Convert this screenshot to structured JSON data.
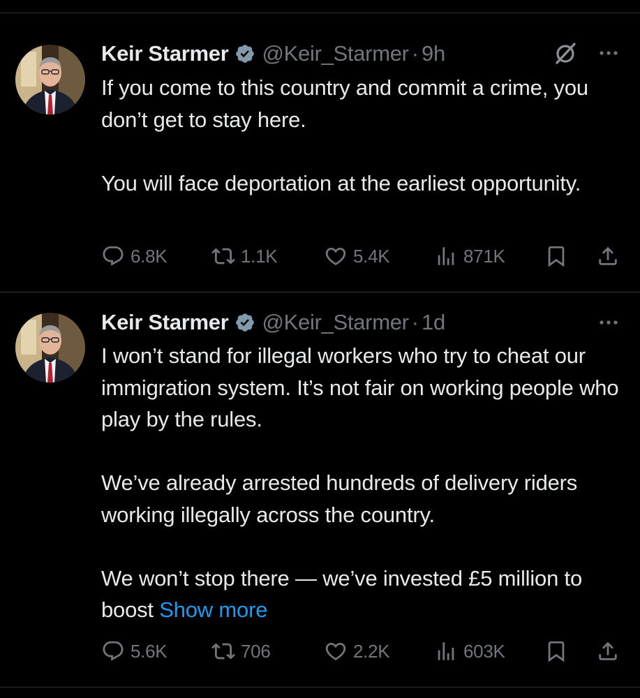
{
  "tweets": [
    {
      "name": "Keir Starmer",
      "handle": "@Keir_Starmer",
      "separator": "·",
      "time": "9h",
      "paragraphs": [
        "If you come to this country and commit a crime, you don’t get to stay here.",
        "You will face deportation at the earliest opportunity."
      ],
      "show_more": "",
      "stats": {
        "replies": "6.8K",
        "reposts": "1.1K",
        "likes": "5.4K",
        "views": "871K"
      }
    },
    {
      "name": "Keir Starmer",
      "handle": "@Keir_Starmer",
      "separator": "·",
      "time": "1d",
      "paragraphs": [
        "I won’t stand for illegal workers who try to cheat our immigration system. It’s not fair on working people who play by the rules.",
        "We’ve already arrested hundreds of delivery riders working illegally across the country.",
        "We won’t stop there — we’ve invested £5 million to boost "
      ],
      "show_more": "Show more",
      "stats": {
        "replies": "5.6K",
        "reposts": "706",
        "likes": "2.2K",
        "views": "603K"
      }
    }
  ],
  "colors": {
    "background": "#000000",
    "text": "#e7e9ea",
    "muted": "#71767b",
    "accent": "#1d9bf0",
    "divider": "#2f3336"
  },
  "icons": [
    "verified-badge-icon",
    "grok-icon",
    "more-icon",
    "reply-icon",
    "repost-icon",
    "like-icon",
    "views-icon",
    "bookmark-icon",
    "share-icon"
  ]
}
